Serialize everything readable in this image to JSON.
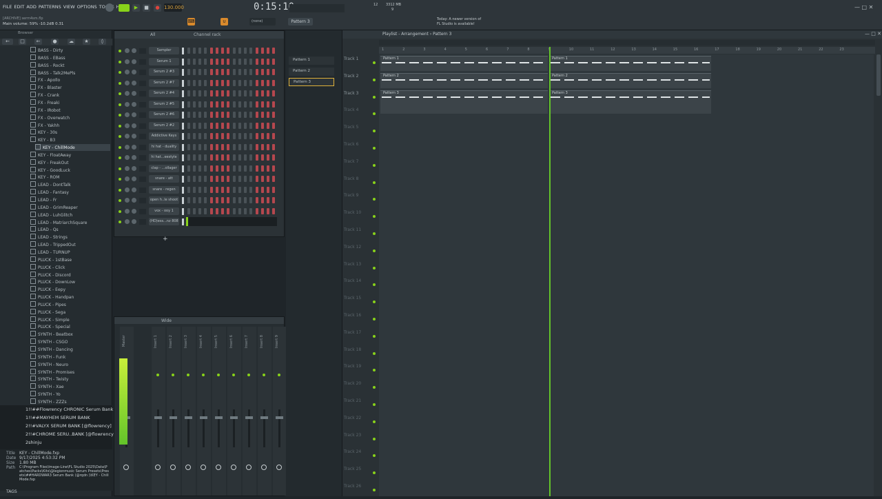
{
  "menu": [
    "FILE",
    "EDIT",
    "ADD",
    "PATTERNS",
    "VIEW",
    "OPTIONS",
    "TOOLS",
    "HELP"
  ],
  "hint": {
    "line1": "[ARCHIVE] serm4sm.flp",
    "line2": "Main volume: 59%  -10.2dB  0.31"
  },
  "tempo": "130.000",
  "time": "0:15:10",
  "cpu": "3312 MB",
  "cpu2": "12",
  "cpu3": "9",
  "pattern_select": "Pattern 3",
  "mixer_none": "(none)",
  "news": {
    "line1": "Today: A newer version of",
    "line2": "FL Studio is available!"
  },
  "browser_title": "Browser",
  "all_label": "All",
  "channel_rack_title": "Channel rack",
  "wide_label": "Wide",
  "playlist_title": "Playlist - Arrangement › Pattern 3",
  "browser_items": [
    "BASS - Dirty",
    "BASS - EBass",
    "BASS - Rockt",
    "BASS - Talk2MePls",
    "FX - Apollo",
    "FX - Blaster",
    "FX - Crank",
    "FX - Freaki",
    "FX - IRobot",
    "FX - Overwatch",
    "FX - Yakhh",
    "KEY - 30s",
    "KEY - B3",
    "KEY - ChillMode",
    "KEY - FloatAway",
    "KEY - FreakOut",
    "KEY - GoodLuck",
    "KEY - ROM",
    "LEAD - DontTalk",
    "LEAD - Fantasy",
    "LEAD - Fr",
    "LEAD - GrimReaper",
    "LEAD - LuhGlitch",
    "LEAD - MatriarchSquare",
    "LEAD - Qs",
    "LEAD - Strings",
    "LEAD - TrippedOut",
    "LEAD - TURNUP",
    "PLUCK - 1stBase",
    "PLUCK - Click",
    "PLUCK - Discord",
    "PLUCK - DownLow",
    "PLUCK - Eepy",
    "PLUCK - Handpan",
    "PLUCK - Pipes",
    "PLUCK - Sega",
    "PLUCK - Simple",
    "PLUCK - Special",
    "SYNTH - Beatbox",
    "SYNTH - CSGO",
    "SYNTH - Dancing",
    "SYNTH - Funk",
    "SYNTH - Neuro",
    "SYNTH - Promises",
    "SYNTH - Twisty",
    "SYNTH - Xae",
    "SYNTH - Yo",
    "SYNTH - ZZZs"
  ],
  "banks": [
    "1!!##Flowrency CHRONIC Serum Bank",
    "1!!##MAYHEM SERUM BANK",
    "2!!#VALYX SERUM BANK [@flowrency]",
    "2!!#CHROME SERU..BANK [@flowrency]",
    "2shinju"
  ],
  "info": {
    "title_label": "Title",
    "title": "KEY - ChillMode.fxp",
    "date_label": "Date",
    "date": "9/17/2025 4:53:32 PM",
    "size_label": "Size",
    "size": "1.80 MB",
    "path_label": "Path",
    "path": "C:\\Program Files\\Image-Line\\FL Studio 2025\\Data\\Patches\\Packs\\Kits\\@legionmusic Serum Presets\\Presets\\##HARDWAR3 Serum Bank (@rqdn )\\KEY - ChillMode.fxp",
    "tags": "TAGS"
  },
  "channels": [
    "Sampler",
    "Serum 1",
    "Serum 2 #3",
    "Serum 2 #7",
    "Serum 2 #4",
    "Serum 2 #5",
    "Serum 2 #6",
    "Serum 2 #2",
    "Addictive Keys",
    "hi hat - duality",
    "hi hat...eestyle",
    "clap - ...ollager",
    "snare - att",
    "snare - regen",
    "open h..le shoot",
    "vox - ooy 1",
    "(HD)ess...nz 808"
  ],
  "mixer_tracks": [
    "Master",
    "Insert 1",
    "Insert 2",
    "Insert 3",
    "Insert 4",
    "Insert 5",
    "Insert 6",
    "Insert 7",
    "Insert 8",
    "Insert 9"
  ],
  "patterns": [
    "Pattern 1",
    "Pattern 2",
    "Pattern 3"
  ],
  "tracks": [
    "Track 1",
    "Track 2",
    "Track 3",
    "Track 4",
    "Track 5",
    "Track 6",
    "Track 7",
    "Track 8",
    "Track 9",
    "Track 10",
    "Track 11",
    "Track 12",
    "Track 13",
    "Track 14",
    "Track 15",
    "Track 16",
    "Track 17",
    "Track 18",
    "Track 19",
    "Track 20",
    "Track 21",
    "Track 22",
    "Track 23",
    "Track 24",
    "Track 25",
    "Track 26"
  ],
  "ruler": [
    "1",
    "2",
    "3",
    "4",
    "5",
    "6",
    "7",
    "8",
    "9",
    "10",
    "11",
    "12",
    "13",
    "14",
    "15",
    "16",
    "17",
    "18",
    "19",
    "20",
    "21",
    "22",
    "23"
  ],
  "clips": [
    {
      "label": "Pattern 1"
    },
    {
      "label": "Pattern 2"
    },
    {
      "label": "Pattern 3"
    }
  ],
  "colors": {
    "accent": "#88d21a",
    "step_on": "#b5474e",
    "step_off": "#4a5257",
    "playhead": "#63c42a"
  }
}
